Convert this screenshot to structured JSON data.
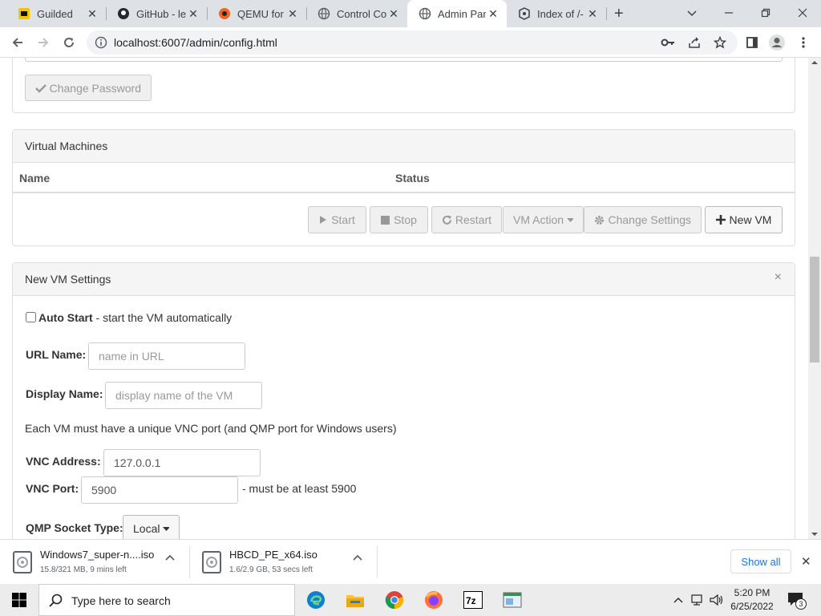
{
  "browser": {
    "tabs": [
      {
        "title": "Guilded",
        "icon": "guilded-icon"
      },
      {
        "title": "GitHub - le",
        "icon": "github-icon"
      },
      {
        "title": "QEMU for \\",
        "icon": "qemu-icon"
      },
      {
        "title": "Control Co",
        "icon": "globe-icon"
      },
      {
        "title": "Admin Pan",
        "icon": "globe-icon",
        "active": true
      },
      {
        "title": "Index of /-",
        "icon": "index-icon"
      }
    ],
    "close_glyph": "✕",
    "new_tab": "+",
    "url": "localhost:6007/admin/config.html"
  },
  "page": {
    "change_password_label": "Change Password",
    "vm_panel": {
      "title": "Virtual Machines",
      "columns": [
        "Name",
        "Status"
      ],
      "buttons": {
        "start": "Start",
        "stop": "Stop",
        "restart": "Restart",
        "vm_action": "VM Action",
        "change_settings": "Change Settings",
        "new_vm": "New VM"
      }
    },
    "new_vm": {
      "title": "New VM Settings",
      "close": "×",
      "auto_start_label": "Auto Start",
      "auto_start_desc": " - start the VM automatically",
      "url_name_label": "URL Name:",
      "url_name_placeholder": "name in URL",
      "display_name_label": "Display Name:",
      "display_name_placeholder": "display name of the VM",
      "vnc_note": "Each VM must have a unique VNC port (and QMP port for Windows users)",
      "vnc_address_label": "VNC Address:",
      "vnc_address_value": "127.0.0.1",
      "vnc_port_label": "VNC Port:",
      "vnc_port_value": "5900",
      "vnc_port_note": "- must be at least 5900",
      "qmp_label": "QMP Socket Type:",
      "qmp_value": "Local"
    }
  },
  "downloads": {
    "items": [
      {
        "name": "Windows7_super-n....iso",
        "status": "15.8/321 MB, 9 mins left"
      },
      {
        "name": "HBCD_PE_x64.iso",
        "status": "1.6/2.9 GB, 53 secs left"
      }
    ],
    "show_all": "Show all",
    "close": "✕"
  },
  "taskbar": {
    "search_placeholder": "Type here to search",
    "time": "5:20 PM",
    "date": "6/25/2022",
    "notifications": "3"
  },
  "colors": {
    "tab_strip": "#dee1e6",
    "panel_heading": "#f5f5f5",
    "border": "#dddddd"
  }
}
